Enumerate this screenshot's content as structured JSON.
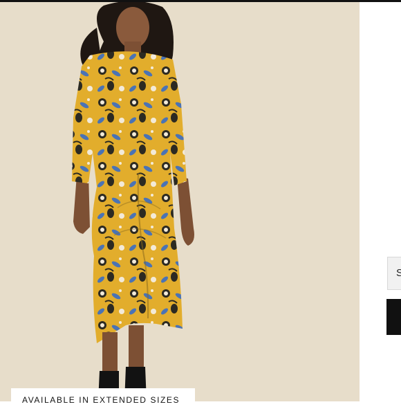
{
  "product_image": {
    "alt": "Model in yellow floral midi dress"
  },
  "badge": {
    "label": "AVAILABLE IN EXTENDED SIZES"
  },
  "right_panel": {
    "size_select_label": "S"
  },
  "colors": {
    "backdrop": "#e7ddca",
    "dress_yellow": "#e2ad2c",
    "floral_blue": "#4a73b5",
    "floral_dark": "#2c2a22",
    "button_black": "#111111"
  }
}
